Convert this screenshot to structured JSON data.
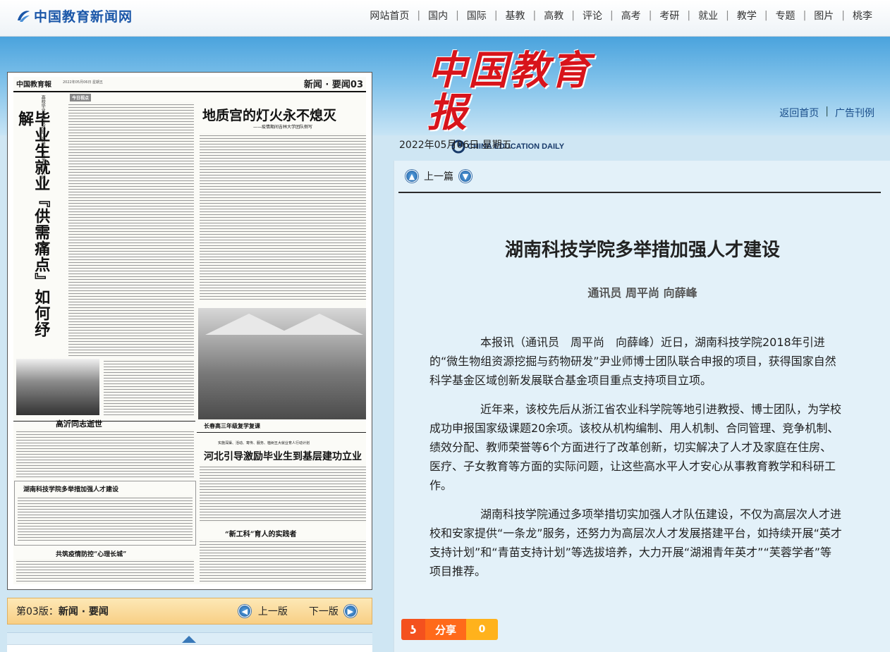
{
  "site": {
    "logo_text": "中国教育新闻网",
    "nav": [
      "网站首页",
      "国内",
      "国际",
      "基教",
      "高教",
      "评论",
      "高考",
      "考研",
      "就业",
      "教学",
      "专题",
      "图片",
      "桃李"
    ]
  },
  "masthead": {
    "cn": "中国教育报",
    "en": "CHINA EDUCATION DAILY"
  },
  "header_links": {
    "home": "返回首页",
    "ads": "广告刊例"
  },
  "date": "2022年05月06日  星期五",
  "newspaper": {
    "mast": "中国教育報",
    "section": "新闻 · 要闻03",
    "headlines": {
      "lead_vertical": "毕业生就业『供需痛点』如何纾解",
      "lead_kicker": "高校毕业生感叹找好工作难，企业发愁招人难——",
      "fire": "地质宫的灯火永不熄灭",
      "fire_sub": "——疫情期间吉林大学团队侧写",
      "obit": "高沂同志逝世",
      "hunan": "湖南科技学院多举措加强人才建设",
      "photo_caption": "长春高三年级复学复课",
      "hebei_kicker": "实施深渠、活动、寄传、服务、植树五大就业育人行动计划",
      "hebei": "河北引导激励毕业生到基层建功立业",
      "new_eng": "“新工科”育人的实践者",
      "epidemic": "共筑疫情防控“心理长城”",
      "tag": "今日视点"
    }
  },
  "page_bar": {
    "label_prefix": "第03版：",
    "label": "新闻 · 要闻",
    "prev": "上一版",
    "next": "下一版"
  },
  "article": {
    "prev_label": "上一篇",
    "title": "湖南科技学院多举措加强人才建设",
    "author": "通讯员 周平尚 向薛峰",
    "paragraphs": [
      "本报讯（通讯员　周平尚　向薛峰）近日，湖南科技学院2018年引进的“微生物组资源挖掘与药物研发”尹业师博士团队联合申报的项目，获得国家自然科学基金区域创新发展联合基金项目重点支持项目立项。",
      "近年来，该校先后从浙江省农业科学院等地引进教授、博士团队，为学校成功申报国家级课题20余项。该校从机构编制、用人机制、合同管理、竞争机制、绩效分配、教师荣誉等6个方面进行了改革创新，切实解决了人才及家庭在住房、医疗、子女教育等方面的实际问题，让这些高水平人才安心从事教育教学和科研工作。",
      "湖南科技学院通过多项举措切实加强人才队伍建设，不仅为高层次人才进校和安家提供“一条龙”服务，还努力为高层次人才发展搭建平台，如持续开展“英才支持计划”和“青苗支持计划”等选拔培养，大力开展“湖湘青年英才”“芙蓉学者”等项目推荐。"
    ],
    "share_label": "分享",
    "share_count": "0"
  }
}
